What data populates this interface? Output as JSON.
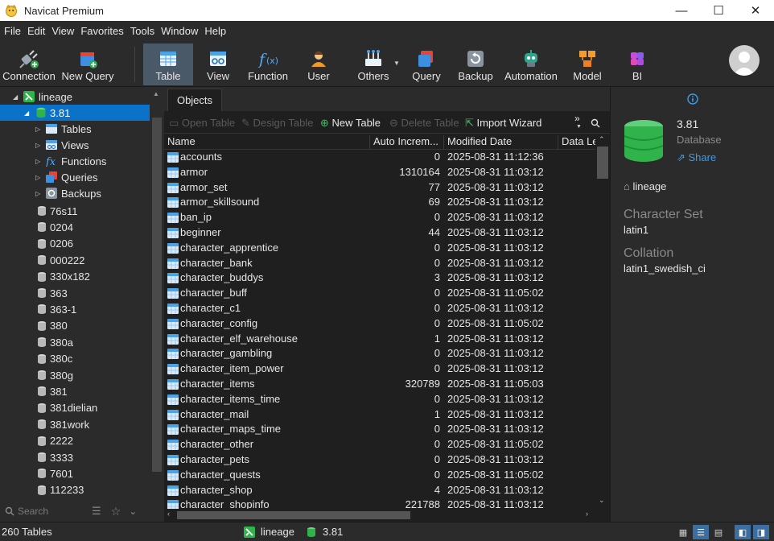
{
  "window": {
    "title": "Navicat Premium",
    "minimize": "—",
    "maximize": "☐",
    "close": "✕"
  },
  "menu": [
    "File",
    "Edit",
    "View",
    "Favorites",
    "Tools",
    "Window",
    "Help"
  ],
  "toolbar": {
    "connection": "Connection",
    "new_query": "New Query",
    "table": "Table",
    "view": "View",
    "function": "Function",
    "user": "User",
    "others": "Others",
    "query": "Query",
    "backup": "Backup",
    "automation": "Automation",
    "model": "Model",
    "bi": "BI"
  },
  "nav": {
    "connection": "lineage",
    "database": "3.81",
    "children": [
      "Tables",
      "Views",
      "Functions",
      "Queries",
      "Backups"
    ],
    "databases": [
      "76s11",
      "0204",
      "0206",
      "000222",
      "330x182",
      "363",
      "363-1",
      "380",
      "380a",
      "380c",
      "380g",
      "381",
      "381dielian",
      "381work",
      "2222",
      "3333",
      "7601",
      "112233"
    ],
    "search_placeholder": "Search"
  },
  "objects": {
    "tab": "Objects",
    "actions": {
      "open_table": "Open Table",
      "design_table": "Design Table",
      "new_table": "New Table",
      "delete_table": "Delete Table",
      "import_wizard": "Import Wizard",
      "more": "»"
    },
    "columns": {
      "name": "Name",
      "auto_increment": "Auto Increm...",
      "modified": "Modified Date",
      "data_length": "Data Le"
    },
    "rows": [
      {
        "name": "accounts",
        "ai": "0",
        "modified": "2025-08-31 11:12:36"
      },
      {
        "name": "armor",
        "ai": "1310164",
        "modified": "2025-08-31 11:03:12"
      },
      {
        "name": "armor_set",
        "ai": "77",
        "modified": "2025-08-31 11:03:12"
      },
      {
        "name": "armor_skillsound",
        "ai": "69",
        "modified": "2025-08-31 11:03:12"
      },
      {
        "name": "ban_ip",
        "ai": "0",
        "modified": "2025-08-31 11:03:12"
      },
      {
        "name": "beginner",
        "ai": "44",
        "modified": "2025-08-31 11:03:12"
      },
      {
        "name": "character_apprentice",
        "ai": "0",
        "modified": "2025-08-31 11:03:12"
      },
      {
        "name": "character_bank",
        "ai": "0",
        "modified": "2025-08-31 11:03:12"
      },
      {
        "name": "character_buddys",
        "ai": "3",
        "modified": "2025-08-31 11:03:12"
      },
      {
        "name": "character_buff",
        "ai": "0",
        "modified": "2025-08-31 11:05:02"
      },
      {
        "name": "character_c1",
        "ai": "0",
        "modified": "2025-08-31 11:03:12"
      },
      {
        "name": "character_config",
        "ai": "0",
        "modified": "2025-08-31 11:05:02"
      },
      {
        "name": "character_elf_warehouse",
        "ai": "1",
        "modified": "2025-08-31 11:03:12"
      },
      {
        "name": "character_gambling",
        "ai": "0",
        "modified": "2025-08-31 11:03:12"
      },
      {
        "name": "character_item_power",
        "ai": "0",
        "modified": "2025-08-31 11:03:12"
      },
      {
        "name": "character_items",
        "ai": "320789",
        "modified": "2025-08-31 11:05:03"
      },
      {
        "name": "character_items_time",
        "ai": "0",
        "modified": "2025-08-31 11:03:12"
      },
      {
        "name": "character_mail",
        "ai": "1",
        "modified": "2025-08-31 11:03:12"
      },
      {
        "name": "character_maps_time",
        "ai": "0",
        "modified": "2025-08-31 11:03:12"
      },
      {
        "name": "character_other",
        "ai": "0",
        "modified": "2025-08-31 11:05:02"
      },
      {
        "name": "character_pets",
        "ai": "0",
        "modified": "2025-08-31 11:03:12"
      },
      {
        "name": "character_quests",
        "ai": "0",
        "modified": "2025-08-31 11:05:02"
      },
      {
        "name": "character_shop",
        "ai": "4",
        "modified": "2025-08-31 11:03:12"
      },
      {
        "name": "character_shopinfo",
        "ai": "221788",
        "modified": "2025-08-31 11:03:12"
      }
    ]
  },
  "info": {
    "name": "3.81",
    "type": "Database",
    "share": "Share",
    "connection": "lineage",
    "charset_label": "Character Set",
    "charset": "latin1",
    "collation_label": "Collation",
    "collation": "latin1_swedish_ci"
  },
  "status": {
    "count": "260 Tables",
    "connection": "lineage",
    "database": "3.81"
  },
  "colors": {
    "accent": "#0a72c9",
    "active_tool": "#4a5968",
    "table_icon": "#4aa3e8",
    "db_icon": "#2fb34a"
  }
}
